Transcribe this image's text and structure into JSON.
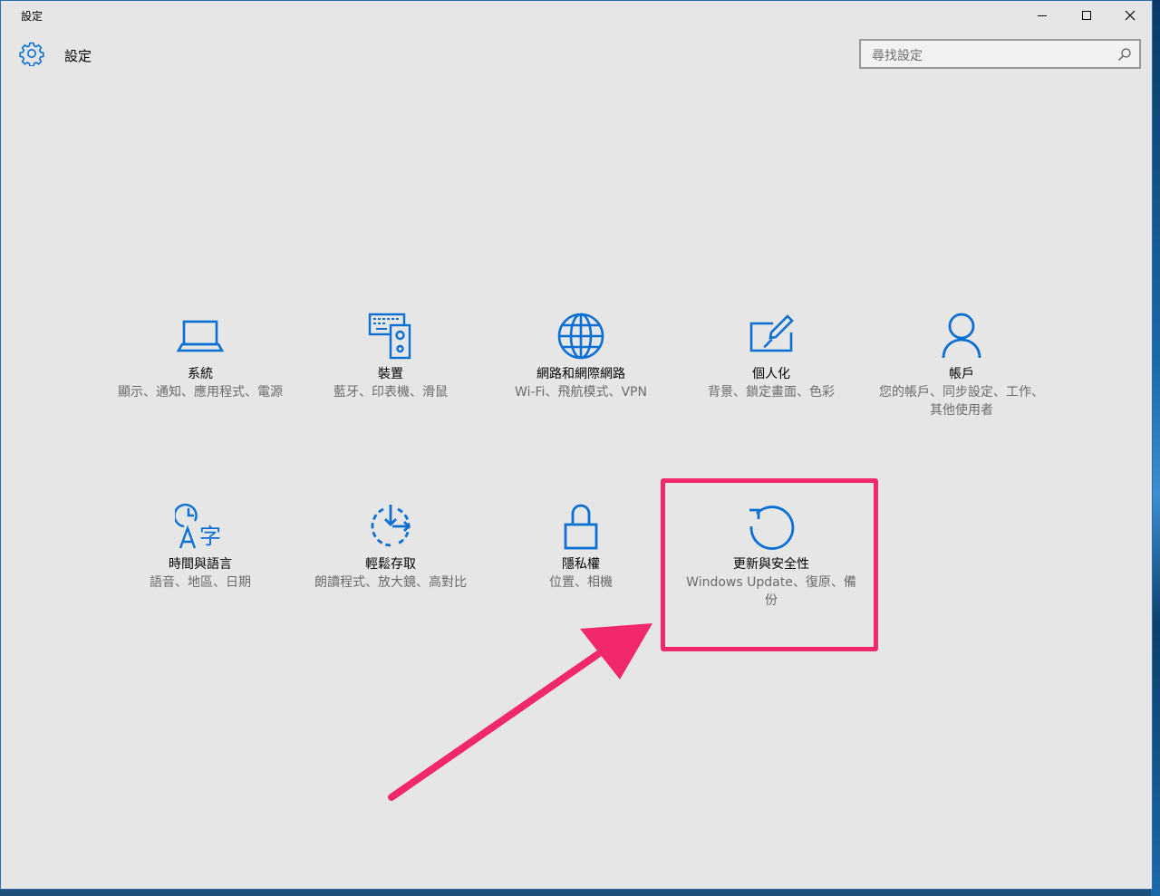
{
  "window": {
    "title": "設定",
    "controls": [
      "minimize",
      "maximize",
      "close"
    ]
  },
  "header": {
    "app_title": "設定",
    "search_placeholder": "尋找設定"
  },
  "tiles": [
    {
      "label": "系統",
      "desc": "顯示、通知、應用程式、電源",
      "icon": "laptop-icon"
    },
    {
      "label": "裝置",
      "desc": "藍牙、印表機、滑鼠",
      "icon": "devices-icon"
    },
    {
      "label": "網路和網際網路",
      "desc": "Wi-Fi、飛航模式、VPN",
      "icon": "globe-icon"
    },
    {
      "label": "個人化",
      "desc": "背景、鎖定畫面、色彩",
      "icon": "personalization-icon"
    },
    {
      "label": "帳戶",
      "desc": "您的帳戶、同步設定、工作、其他使用者",
      "icon": "person-icon"
    },
    {
      "label": "時間與語言",
      "desc": "語音、地區、日期",
      "icon": "time-language-icon"
    },
    {
      "label": "輕鬆存取",
      "desc": "朗讀程式、放大鏡、高對比",
      "icon": "ease-of-access-icon"
    },
    {
      "label": "隱私權",
      "desc": "位置、相機",
      "icon": "lock-icon"
    },
    {
      "label": "更新與安全性",
      "desc": "Windows Update、復原、備份",
      "icon": "update-icon"
    }
  ],
  "colors": {
    "accent": "#0a6fd3",
    "highlight": "#f1286a",
    "background": "#e6e6e6"
  }
}
